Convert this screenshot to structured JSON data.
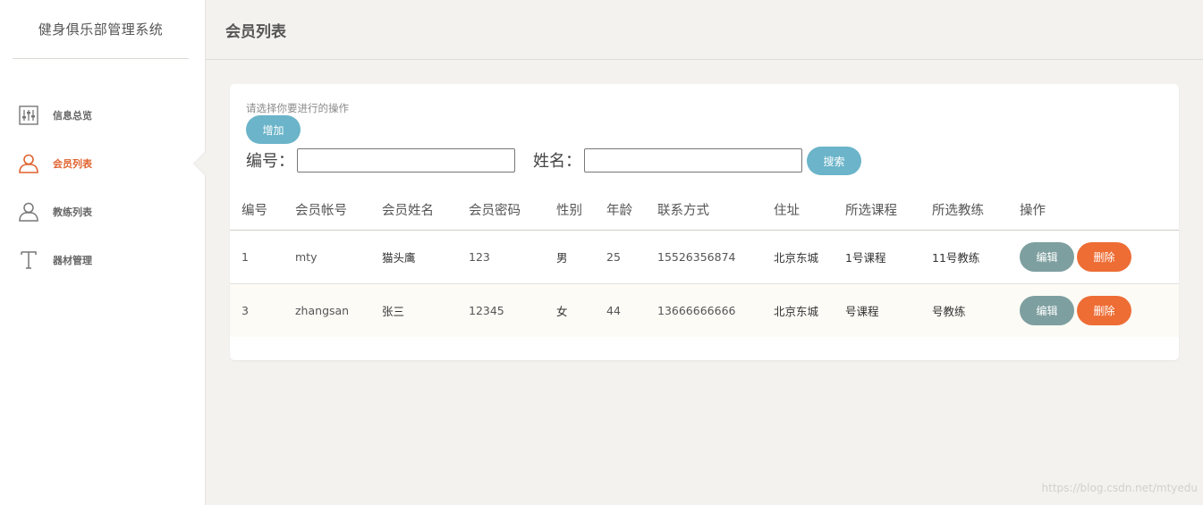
{
  "app": {
    "title": "健身俱乐部管理系统"
  },
  "sidebar": {
    "items": [
      {
        "label": "信息总览",
        "icon": "sliders-icon",
        "active": false
      },
      {
        "label": "会员列表",
        "icon": "user-icon",
        "active": true
      },
      {
        "label": "教练列表",
        "icon": "user-icon",
        "active": false
      },
      {
        "label": "器材管理",
        "icon": "text-t-icon",
        "active": false
      }
    ]
  },
  "header": {
    "title": "会员列表"
  },
  "panel": {
    "hint": "请选择你要进行的操作",
    "add_label": "增加",
    "search": {
      "id_label": "编号：",
      "id_value": "",
      "name_label": "姓名：",
      "name_value": "",
      "button_label": "搜索"
    }
  },
  "table": {
    "headers": [
      "编号",
      "会员帐号",
      "会员姓名",
      "会员密码",
      "性别",
      "年龄",
      "联系方式",
      "住址",
      "所选课程",
      "所选教练",
      "操作"
    ],
    "rows": [
      {
        "id": "1",
        "account": "mty",
        "name": "猫头鹰",
        "password": "123",
        "gender": "男",
        "age": "25",
        "phone": "15526356874",
        "address": "北京东城",
        "course": "1号课程",
        "coach": "11号教练",
        "edit": "编辑",
        "delete": "删除"
      },
      {
        "id": "3",
        "account": "zhangsan",
        "name": "张三",
        "password": "12345",
        "gender": "女",
        "age": "44",
        "phone": "13666666666",
        "address": "北京东城",
        "course": "号课程",
        "coach": "号教练",
        "edit": "编辑",
        "delete": "删除"
      }
    ]
  },
  "watermark": "https://blog.csdn.net/mtyedu",
  "colors": {
    "accent": "#e0622f",
    "button_blue": "#6bb4c9",
    "edit_button": "#7e9fa0",
    "delete_button": "#ee6d35",
    "background": "#f3f2ef"
  }
}
